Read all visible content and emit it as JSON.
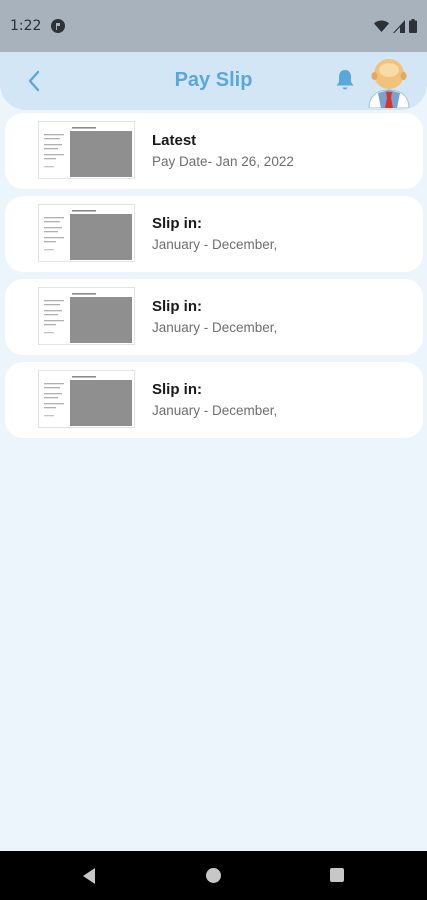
{
  "status_bar": {
    "time": "1:22",
    "icons": [
      "app-notification-icon",
      "wifi-icon",
      "signal-icon",
      "battery-icon"
    ]
  },
  "header": {
    "title": "Pay Slip",
    "back_icon": "chevron-left-icon",
    "bell_icon": "bell-icon",
    "avatar_icon": "avatar-icon"
  },
  "slips": [
    {
      "title": "Latest",
      "subtitle": "Pay Date- Jan 26, 2022"
    },
    {
      "title": "Slip in:",
      "subtitle": "January - December,"
    },
    {
      "title": "Slip in:",
      "subtitle": "January - December,"
    },
    {
      "title": "Slip in:",
      "subtitle": "January - December,"
    }
  ],
  "nav": {
    "back_icon": "nav-back-icon",
    "home_icon": "nav-home-icon",
    "recents_icon": "nav-recents-icon"
  },
  "colors": {
    "accent": "#5aa7de",
    "header_bg": "#d2e6f6",
    "page_bg": "#edf5fc",
    "status_bar_bg": "#a7b2bd",
    "card_bg": "#ffffff"
  }
}
